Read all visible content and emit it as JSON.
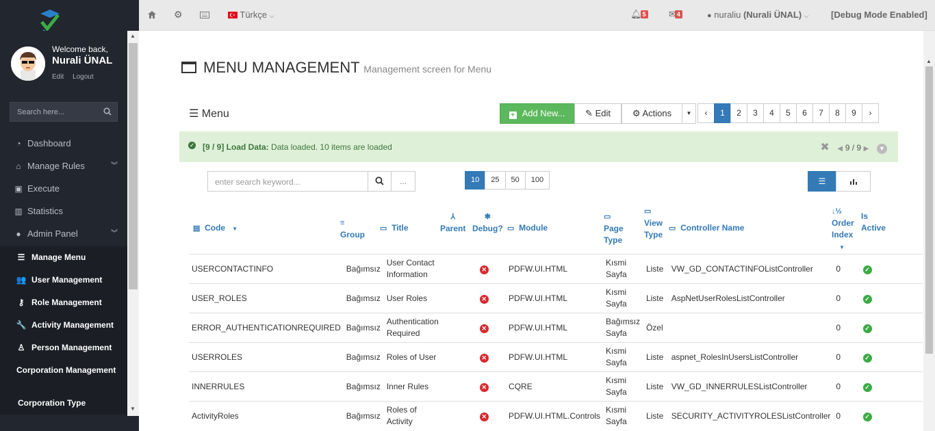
{
  "sidebar": {
    "profile": {
      "welcome": "Welcome back,",
      "name": "Nurali ÜNAL",
      "edit": "Edit",
      "logout": "Logout"
    },
    "search_placeholder": "Search here...",
    "menu": [
      {
        "label": "Dashboard",
        "icon": "tachometer-icon"
      },
      {
        "label": "Manage Rules",
        "icon": "home-icon",
        "expandable": true
      },
      {
        "label": "Execute",
        "icon": "play-icon"
      },
      {
        "label": "Statistics",
        "icon": "bar-chart-icon"
      },
      {
        "label": "Admin Panel",
        "icon": "user-icon",
        "expandable": true
      }
    ],
    "submenu": [
      {
        "label": "Manage Menu",
        "icon": "list-icon"
      },
      {
        "label": "User Management",
        "icon": "users-icon"
      },
      {
        "label": "Role Management",
        "icon": "key-icon"
      },
      {
        "label": "Activity Management",
        "icon": "wrench-icon"
      },
      {
        "label": "Person Management",
        "icon": "user-outline-icon"
      },
      {
        "label": "Corporation Management"
      },
      {
        "label": "Corporation Type"
      }
    ]
  },
  "topbar": {
    "language": "Türkçe",
    "notifications": "5",
    "messages": "4",
    "user": "nuraliu",
    "user_full": "(Nurali ÜNAL)",
    "debug": "[Debug Mode Enabled]"
  },
  "page": {
    "title": "MENU MANAGEMENT",
    "subtitle": "Management screen for Menu",
    "section": "Menu",
    "buttons": {
      "add": "Add New...",
      "edit": "Edit",
      "actions": "Actions"
    },
    "pages": [
      "1",
      "2",
      "3",
      "4",
      "5",
      "6",
      "7",
      "8",
      "9"
    ],
    "active_page": "1"
  },
  "alert": {
    "prefix": "[9 / 9] Load Data:",
    "message": "Data loaded. 10 items are loaded",
    "counter": "9 / 9"
  },
  "search": {
    "placeholder": "enter search keyword...",
    "more": "..."
  },
  "page_sizes": [
    "10",
    "25",
    "50",
    "100"
  ],
  "active_page_size": "10",
  "columns": {
    "code": "Code",
    "group": "Group",
    "title": "Title",
    "parent": "Parent",
    "debug": "Debug?",
    "module": "Module",
    "page_type": "Page Type",
    "view_type": "View Type",
    "controller": "Controller Name",
    "order": "Order Index",
    "active": "Is Active"
  },
  "rows": [
    {
      "code": "USERCONTACTINFO",
      "group": "Bağımsız",
      "title": "User Contact Information",
      "module": "PDFW.UI.HTML",
      "page_type": "Kısmi Sayfa",
      "view_type": "Liste",
      "controller": "VW_GD_CONTACTINFOListController",
      "order": "0"
    },
    {
      "code": "USER_ROLES",
      "group": "Bağımsız",
      "title": "User Roles",
      "module": "PDFW.UI.HTML",
      "page_type": "Kısmi Sayfa",
      "view_type": "Liste",
      "controller": "AspNetUserRolesListController",
      "order": "0"
    },
    {
      "code": "ERROR_AUTHENTICATIONREQUIRED",
      "group": "Bağımsız",
      "title": "Authentication Required",
      "module": "PDFW.UI.HTML",
      "page_type": "Bağımsız Sayfa",
      "view_type": "Özel",
      "controller": "",
      "order": "0"
    },
    {
      "code": "USERROLES",
      "group": "Bağımsız",
      "title": "Roles of User",
      "module": "PDFW.UI.HTML",
      "page_type": "Kısmi Sayfa",
      "view_type": "Liste",
      "controller": "aspnet_RolesInUsersListController",
      "order": "0"
    },
    {
      "code": "INNERRULES",
      "group": "Bağımsız",
      "title": "Inner Rules",
      "module": "CQRE",
      "page_type": "Kısmi Sayfa",
      "view_type": "Liste",
      "controller": "VW_GD_INNERRULESListController",
      "order": "0"
    },
    {
      "code": "ActivityRoles",
      "group": "Bağımsız",
      "title": "Roles of Activity",
      "module": "PDFW.UI.HTML.Controls",
      "page_type": "Kısmi Sayfa",
      "view_type": "Liste",
      "controller": "SECURITY_ACTIVITYROLESListController",
      "order": "0"
    }
  ]
}
